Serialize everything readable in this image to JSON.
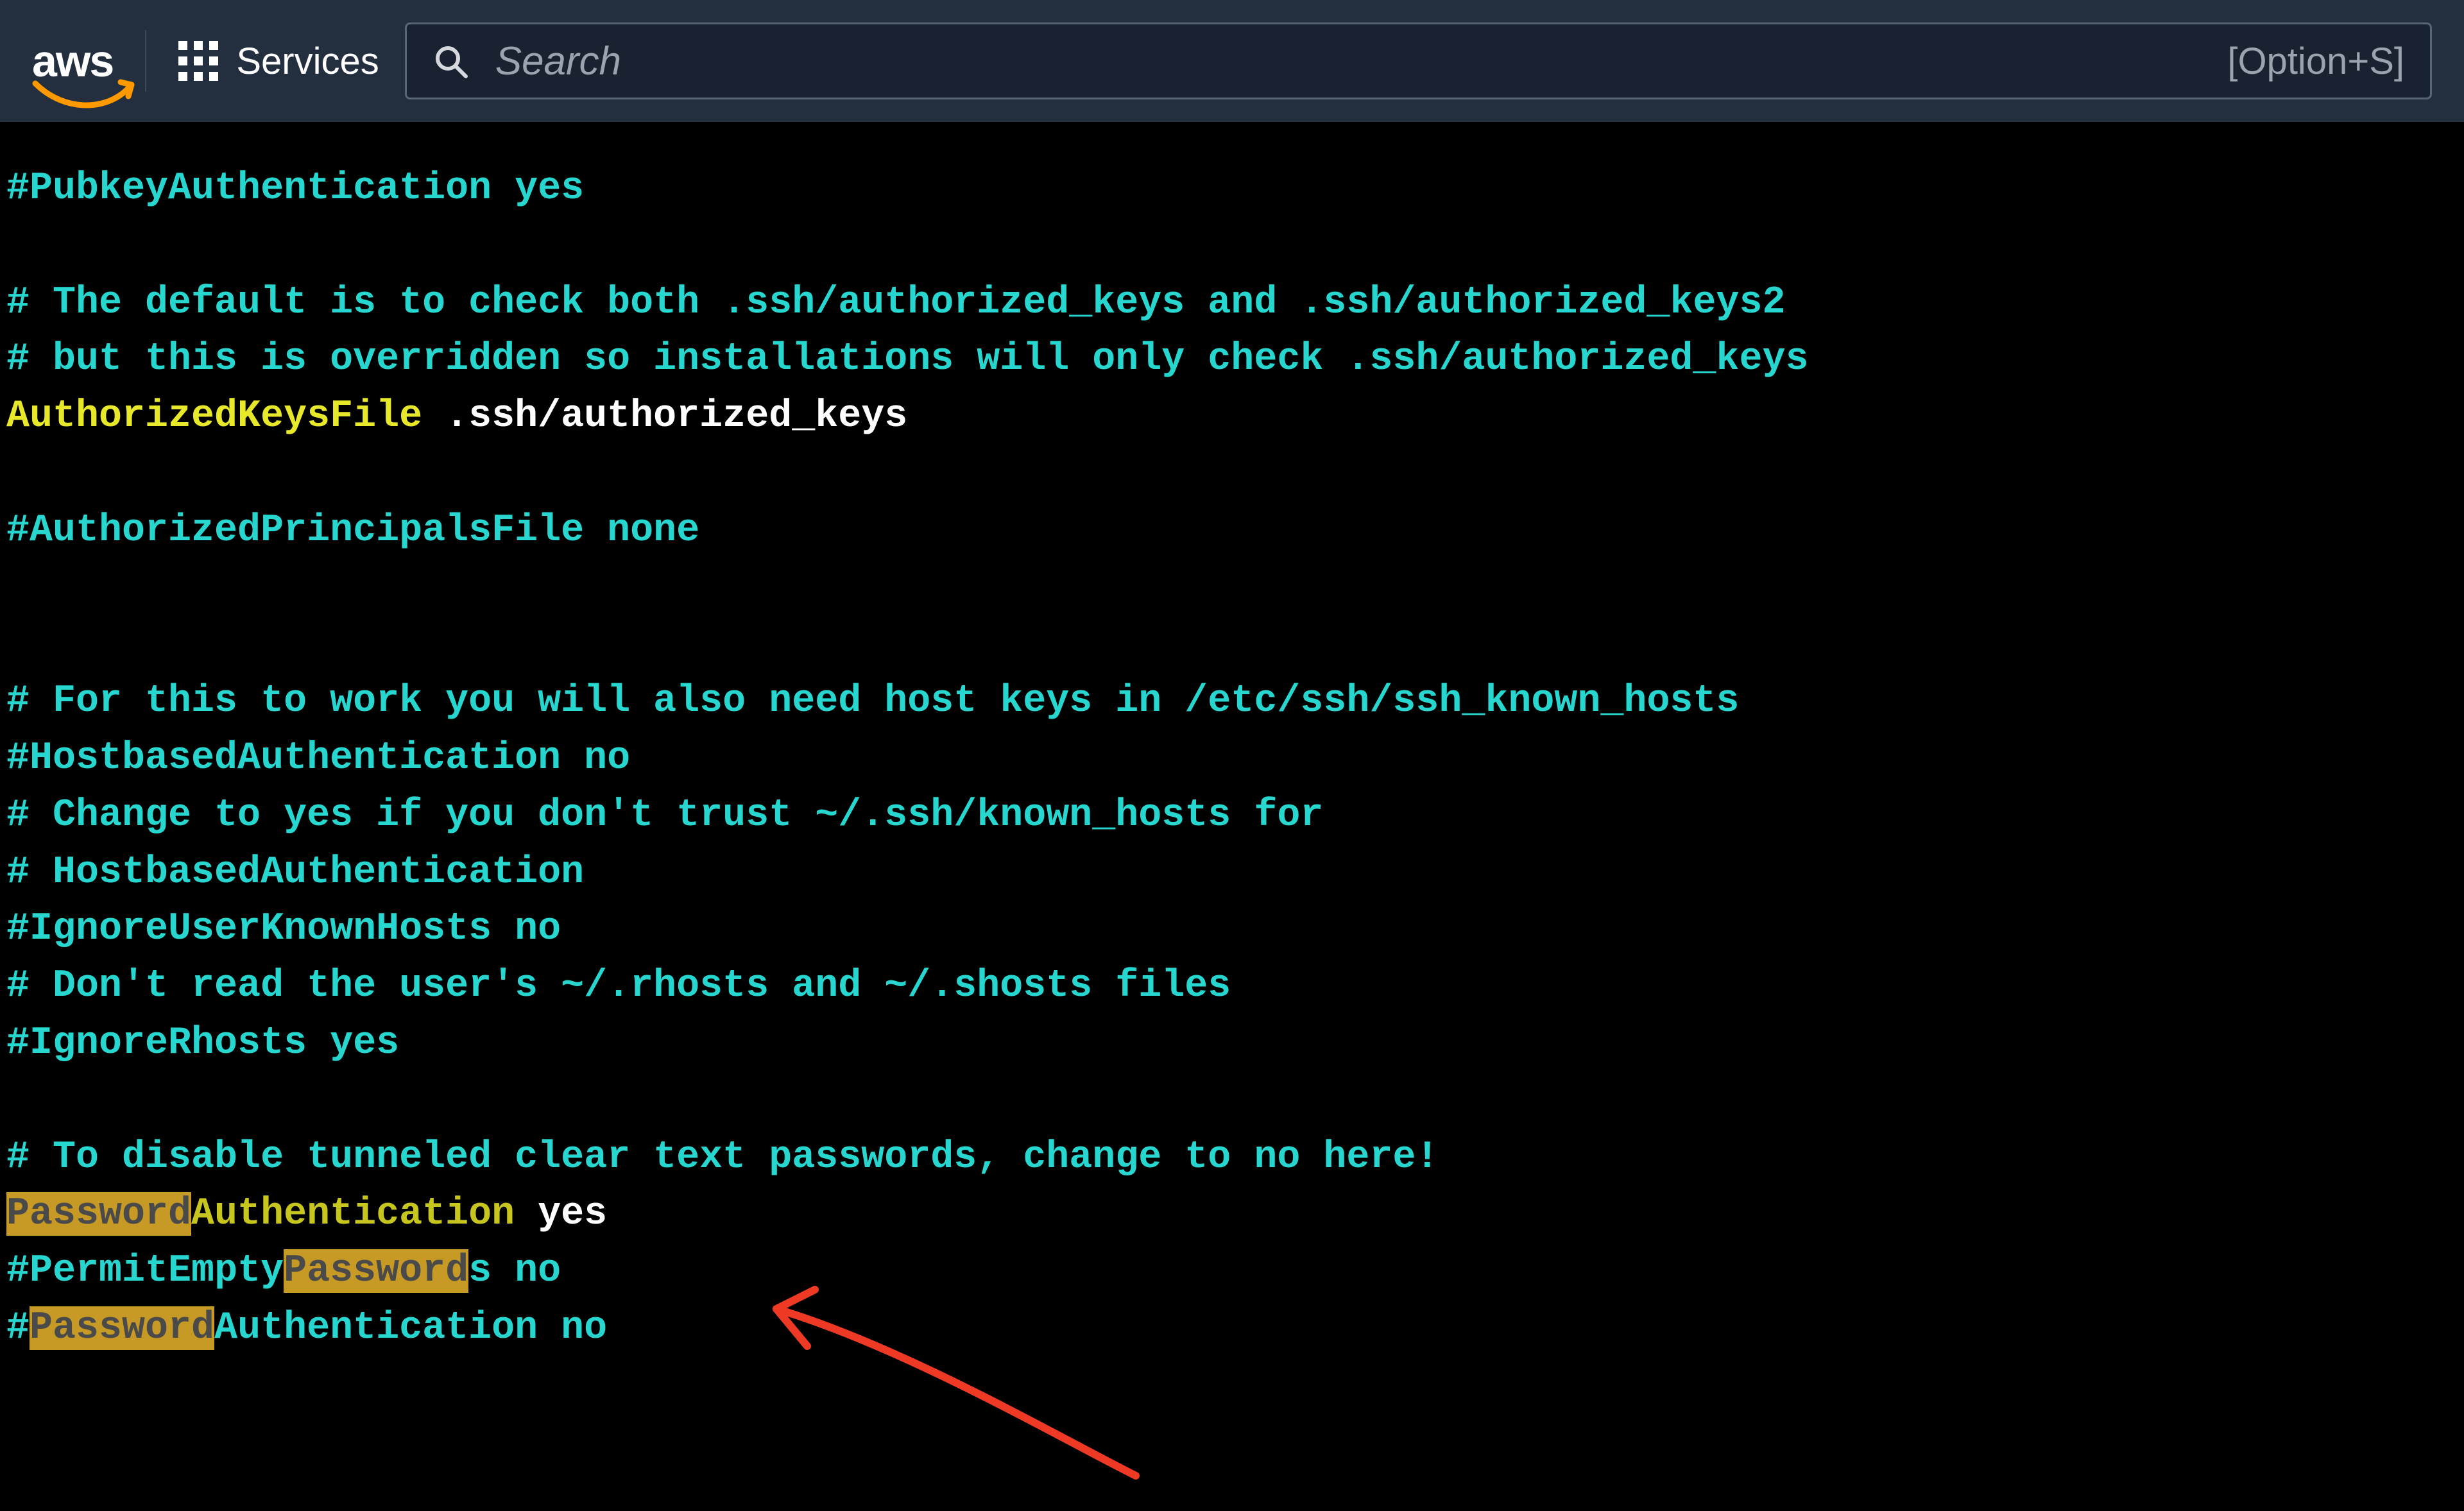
{
  "navbar": {
    "logo_text": "aws",
    "services_label": "Services",
    "search_placeholder": "Search",
    "kbd_hint": "[Option+S]"
  },
  "config": {
    "l1": "#PubkeyAuthentication yes",
    "l2": "# The default is to check both .ssh/authorized_keys and .ssh/authorized_keys2",
    "l3": "# but this is overridden so installations will only check .ssh/authorized_keys",
    "l4a": "AuthorizedKeysFile",
    "l4b": " .ssh/authorized_keys",
    "l5": "#AuthorizedPrincipalsFile none",
    "l6": "# For this to work you will also need host keys in /etc/ssh/ssh_known_hosts",
    "l7": "#HostbasedAuthentication no",
    "l8": "# Change to yes if you don't trust ~/.ssh/known_hosts for",
    "l9": "# HostbasedAuthentication",
    "l10": "#IgnoreUserKnownHosts no",
    "l11": "# Don't read the user's ~/.rhosts and ~/.shosts files",
    "l12": "#IgnoreRhosts yes",
    "l13": "# To disable tunneled clear text passwords, change to no here!",
    "l14_hl": "Password",
    "l14a": "Authentication",
    "l14b": " yes",
    "l15a": "#",
    "l15b": "PermitEmpty",
    "l15_hl": "Password",
    "l15c": "s",
    "l15d": " no",
    "l16a": "#",
    "l16_hl": "Password",
    "l16b": "Authentication",
    "l16c": " no"
  }
}
